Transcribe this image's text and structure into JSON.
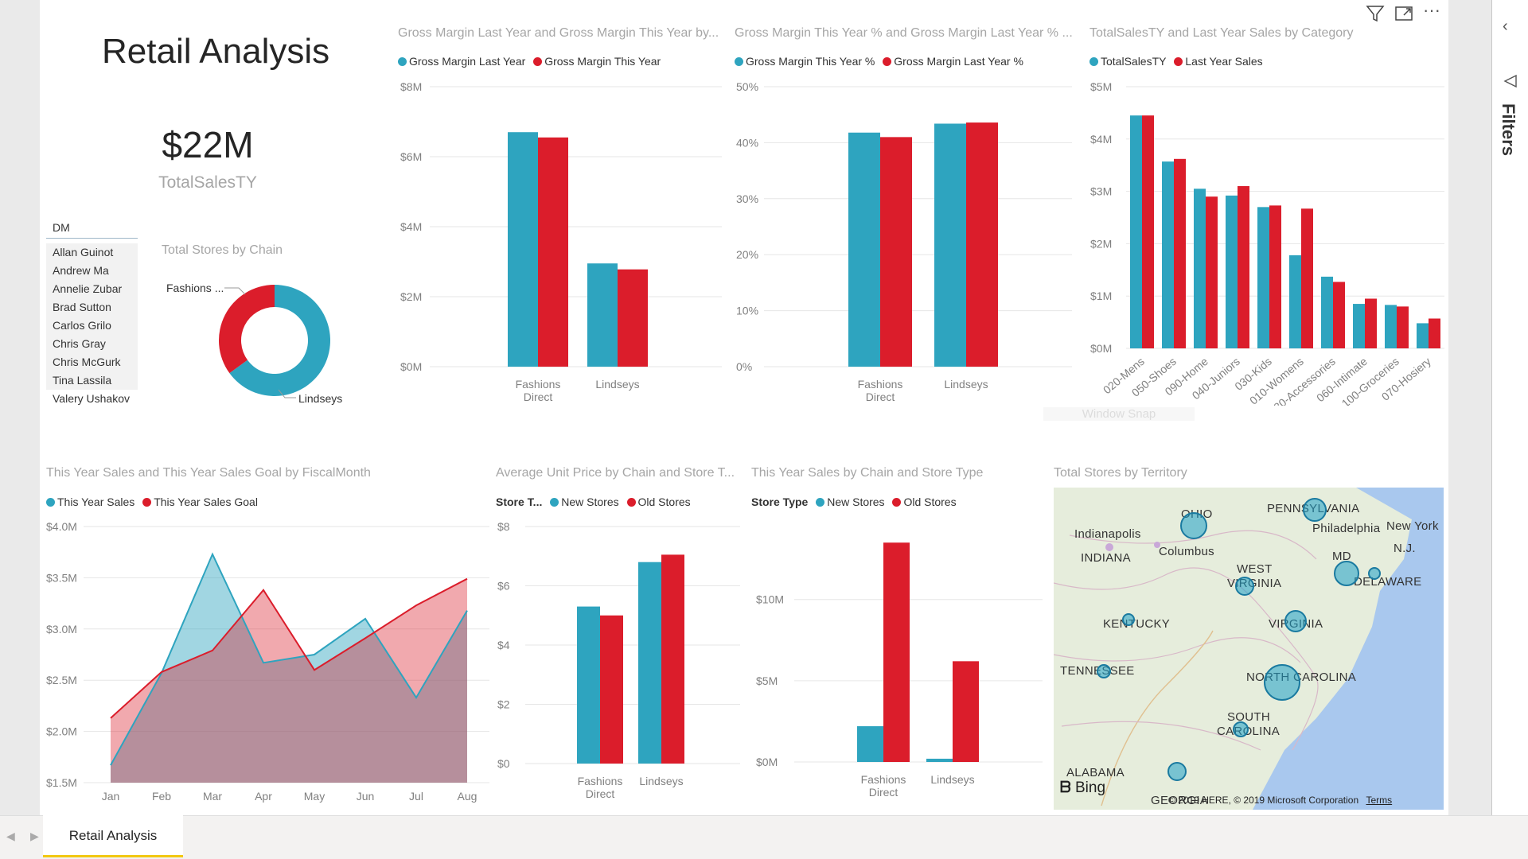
{
  "report": {
    "title": "Retail Analysis",
    "tab_label": "Retail Analysis",
    "watermark": "Window Snap"
  },
  "kpi": {
    "value": "$22M",
    "label": "TotalSalesTY"
  },
  "slicer": {
    "header": "DM",
    "items": [
      "Allan Guinot",
      "Andrew Ma",
      "Annelie Zubar",
      "Brad Sutton",
      "Carlos Grilo",
      "Chris Gray",
      "Chris McGurk",
      "Tina Lassila",
      "Valery Ushakov"
    ]
  },
  "colors": {
    "teal": "#2ea4bf",
    "red": "#db1d2b"
  },
  "visuals": {
    "donut": {
      "title": "Total Stores by Chain",
      "label_fashions": "Fashions ...",
      "label_lindseys": "Lindseys"
    },
    "gm": {
      "title": "Gross Margin Last Year and Gross Margin This Year by...",
      "legend": [
        "Gross Margin Last Year",
        "Gross Margin This Year"
      ]
    },
    "gmpct": {
      "title": "Gross Margin This Year % and Gross Margin Last Year % ...",
      "legend": [
        "Gross Margin This Year %",
        "Gross Margin Last Year %"
      ]
    },
    "cat": {
      "title": "TotalSalesTY and Last Year Sales by Category",
      "legend": [
        "TotalSalesTY",
        "Last Year Sales"
      ]
    },
    "area": {
      "title": "This Year Sales and This Year Sales Goal by FiscalMonth",
      "legend": [
        "This Year Sales",
        "This Year Sales Goal"
      ]
    },
    "aup": {
      "title": "Average Unit Price by Chain and Store T...",
      "legend_title": "Store T...",
      "legend": [
        "New Stores",
        "Old Stores"
      ]
    },
    "tys": {
      "title": "This Year Sales by Chain and Store Type",
      "legend_title": "Store Type",
      "legend": [
        "New Stores",
        "Old Stores"
      ]
    },
    "map": {
      "title": "Total Stores by Territory",
      "bing": "Bing",
      "copyright": "© 2019 HERE, © 2019 Microsoft Corporation",
      "terms": "Terms"
    }
  },
  "map_labels": [
    "OHIO",
    "Indianapolis",
    "INDIANA",
    "Columbus",
    "PENNSYLVANIA",
    "Philadelphia",
    "New York",
    "N.J.",
    "MD",
    "DELAWARE",
    "WEST",
    "VIRGINIA",
    "KENTUCKY",
    "VIRGINIA",
    "TENNESSEE",
    "NORTH CAROLINA",
    "SOUTH",
    "CAROLINA",
    "ALABAMA",
    "GEORGIA"
  ],
  "pane": {
    "filters_label": "Filters"
  },
  "chart_data": [
    {
      "type": "pie",
      "id": "donut",
      "title": "Total Stores by Chain",
      "categories": [
        "Fashions Direct",
        "Lindseys"
      ],
      "values": [
        65,
        35
      ]
    },
    {
      "type": "bar",
      "id": "gm",
      "title": "Gross Margin Last Year and Gross Margin This Year by...",
      "categories": [
        "Fashions Direct",
        "Lindseys"
      ],
      "series": [
        {
          "name": "Gross Margin Last Year",
          "values": [
            6.7,
            2.95
          ]
        },
        {
          "name": "Gross Margin This Year",
          "values": [
            6.55,
            2.78
          ]
        }
      ],
      "ylim": [
        0,
        8
      ],
      "yticks": [
        "$0M",
        "$2M",
        "$4M",
        "$6M",
        "$8M"
      ]
    },
    {
      "type": "bar",
      "id": "gmpct",
      "title": "Gross Margin This Year % and Gross Margin Last Year % ...",
      "categories": [
        "Fashions Direct",
        "Lindseys"
      ],
      "series": [
        {
          "name": "Gross Margin This Year %",
          "values": [
            41.8,
            43.4
          ]
        },
        {
          "name": "Gross Margin Last Year %",
          "values": [
            41.0,
            43.6
          ]
        }
      ],
      "ylim": [
        0,
        50
      ],
      "yticks": [
        "0%",
        "10%",
        "20%",
        "30%",
        "40%",
        "50%"
      ]
    },
    {
      "type": "bar",
      "id": "cat",
      "title": "TotalSalesTY and Last Year Sales by Category",
      "categories": [
        "020-Mens",
        "050-Shoes",
        "090-Home",
        "040-Juniors",
        "030-Kids",
        "010-Womens",
        "080-Accessories",
        "060-Intimate",
        "100-Groceries",
        "070-Hosiery"
      ],
      "series": [
        {
          "name": "TotalSalesTY",
          "values": [
            4.45,
            3.57,
            3.05,
            2.92,
            2.7,
            1.78,
            1.37,
            0.85,
            0.83,
            0.48
          ]
        },
        {
          "name": "Last Year Sales",
          "values": [
            4.45,
            3.62,
            2.9,
            3.1,
            2.73,
            2.67,
            1.27,
            0.95,
            0.8,
            0.57
          ]
        }
      ],
      "ylim": [
        0,
        5
      ],
      "yticks": [
        "$0M",
        "$1M",
        "$2M",
        "$3M",
        "$4M",
        "$5M"
      ]
    },
    {
      "type": "area",
      "id": "area",
      "title": "This Year Sales and This Year Sales Goal by FiscalMonth",
      "categories": [
        "Jan",
        "Feb",
        "Mar",
        "Apr",
        "May",
        "Jun",
        "Jul",
        "Aug"
      ],
      "series": [
        {
          "name": "This Year Sales",
          "values": [
            1.67,
            2.57,
            3.73,
            2.67,
            2.75,
            3.1,
            2.33,
            3.18
          ]
        },
        {
          "name": "This Year Sales Goal",
          "values": [
            2.13,
            2.58,
            2.79,
            3.38,
            2.6,
            2.91,
            3.23,
            3.49
          ]
        }
      ],
      "ylim": [
        1.5,
        4.0
      ],
      "yticks": [
        "$1.5M",
        "$2.0M",
        "$2.5M",
        "$3.0M",
        "$3.5M",
        "$4.0M"
      ]
    },
    {
      "type": "bar",
      "id": "aup",
      "title": "Average Unit Price by Chain and Store T...",
      "categories": [
        "Fashions Direct",
        "Lindseys"
      ],
      "series": [
        {
          "name": "New Stores",
          "values": [
            5.3,
            6.8
          ]
        },
        {
          "name": "Old Stores",
          "values": [
            5.0,
            7.05
          ]
        }
      ],
      "ylim": [
        0,
        8
      ],
      "yticks": [
        "$0",
        "$2",
        "$4",
        "$6",
        "$8"
      ]
    },
    {
      "type": "bar",
      "id": "tys",
      "title": "This Year Sales by Chain and Store Type",
      "categories": [
        "Fashions Direct",
        "Lindseys"
      ],
      "series": [
        {
          "name": "New Stores",
          "values": [
            2.2,
            0.2
          ]
        },
        {
          "name": "Old Stores",
          "values": [
            13.5,
            6.2
          ]
        }
      ],
      "ylim": [
        0,
        14
      ],
      "yticks": [
        "$0M",
        "$5M",
        "$10M"
      ]
    }
  ]
}
